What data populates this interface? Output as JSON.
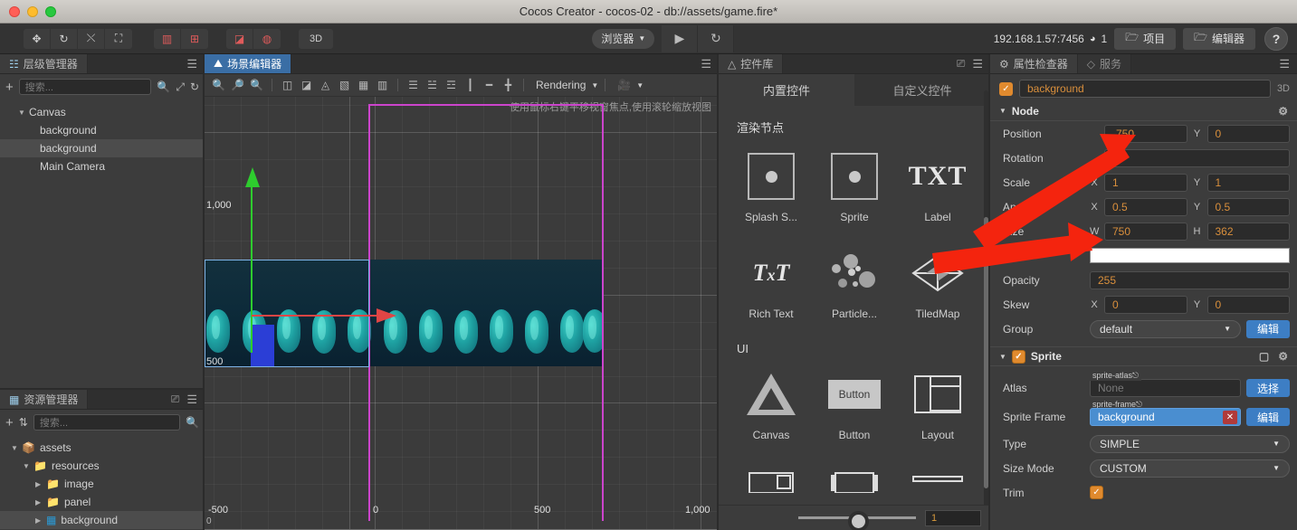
{
  "window": {
    "title": "Cocos Creator - cocos-02 - db://assets/game.fire*"
  },
  "toolbar": {
    "transform_tools": [
      {
        "name": "move-tool",
        "glyph": "✥"
      },
      {
        "name": "rotate-tool",
        "glyph": "⟳"
      },
      {
        "name": "scale-tool",
        "glyph": "⤢"
      },
      {
        "name": "rect-tool",
        "glyph": "⛶"
      }
    ],
    "pivot_tools": [
      {
        "name": "pivot-tool",
        "glyph": "▦"
      },
      {
        "name": "coord-tool",
        "glyph": "⊞"
      }
    ],
    "align_tools": [
      {
        "name": "align-tool",
        "glyph": "◲"
      },
      {
        "name": "lock-tool",
        "glyph": "◍"
      }
    ],
    "mode_3d_label": "3D",
    "preview_target": "浏览器",
    "play_glyph": "▶",
    "refresh_glyph": "↻",
    "address": "192.168.1.57:7456",
    "device_count": "1",
    "project_label": "项目",
    "editor_label": "编辑器",
    "help_label": "?"
  },
  "hierarchy": {
    "tab_label": "层级管理器",
    "search_placeholder": "搜索...",
    "nodes": [
      {
        "label": "Canvas",
        "depth": 0,
        "expandable": true,
        "selected": false
      },
      {
        "label": "background",
        "depth": 1,
        "expandable": false,
        "selected": false
      },
      {
        "label": "background",
        "depth": 1,
        "expandable": false,
        "selected": true
      },
      {
        "label": "Main Camera",
        "depth": 1,
        "expandable": false,
        "selected": false
      }
    ]
  },
  "assets": {
    "tab_label": "资源管理器",
    "search_placeholder": "搜索...",
    "nodes": [
      {
        "label": "assets",
        "depth": 0,
        "expandable": true,
        "selected": false,
        "icon": "package-icon"
      },
      {
        "label": "resources",
        "depth": 1,
        "expandable": true,
        "selected": false,
        "icon": "folder-icon"
      },
      {
        "label": "image",
        "depth": 2,
        "expandable": true,
        "selected": false,
        "icon": "folder-icon"
      },
      {
        "label": "panel",
        "depth": 2,
        "expandable": true,
        "selected": false,
        "icon": "folder-icon"
      },
      {
        "label": "background",
        "depth": 2,
        "expandable": true,
        "selected": true,
        "icon": "texture-icon"
      }
    ]
  },
  "scene": {
    "tab_label": "场景编辑器",
    "rendering_label": "Rendering",
    "hint": "使用鼠标右键平移视窗焦点,使用滚轮缩放视图",
    "axis_labels": {
      "y_1000": "1,000",
      "y_500": "500",
      "x_neg500": "-500",
      "x_0": "0",
      "x_500": "500",
      "x_1000": "1,000",
      "origin": "0"
    }
  },
  "widgets": {
    "tab_label": "控件库",
    "tabs": [
      {
        "label": "内置控件",
        "active": true
      },
      {
        "label": "自定义控件",
        "active": false
      }
    ],
    "sections": [
      {
        "title": "渲染节点",
        "items": [
          {
            "label": "Splash S...",
            "icon": "splash-icon"
          },
          {
            "label": "Sprite",
            "icon": "sprite-icon"
          },
          {
            "label": "Label",
            "icon": "txt-icon"
          },
          {
            "label": "Rich Text",
            "icon": "rich-text-icon"
          },
          {
            "label": "Particle...",
            "icon": "particle-icon"
          },
          {
            "label": "TiledMap",
            "icon": "tiledmap-icon"
          }
        ]
      },
      {
        "title": "UI",
        "items": [
          {
            "label": "Canvas",
            "icon": "canvas-icon"
          },
          {
            "label": "Button",
            "icon": "button-icon"
          },
          {
            "label": "Layout",
            "icon": "layout-icon"
          }
        ]
      }
    ],
    "zoom_value": "1"
  },
  "inspector": {
    "tabs": [
      {
        "label": "属性检查器",
        "active": true
      },
      {
        "label": "服务",
        "active": false
      }
    ],
    "node_name": "background",
    "node_enabled": true,
    "mode_3d_label": "3D",
    "node_section": {
      "title": "Node",
      "position": {
        "label": "Position",
        "x": "-750",
        "y": "0",
        "x_axis": "",
        "y_axis": "Y"
      },
      "rotation": {
        "label": "Rotation",
        "value": "0"
      },
      "scale": {
        "label": "Scale",
        "x_axis": "X",
        "x": "1",
        "y_axis": "Y",
        "y": "1"
      },
      "anchor": {
        "label": "Anchor",
        "x_axis": "X",
        "x": "0.5",
        "y_axis": "Y",
        "y": "0.5"
      },
      "size": {
        "label": "Size",
        "w_axis": "W",
        "w": "750",
        "h_axis": "H",
        "h": "362"
      },
      "color": {
        "label": "Color",
        "value": "#FFFFFF"
      },
      "opacity": {
        "label": "Opacity",
        "value": "255"
      },
      "skew": {
        "label": "Skew",
        "x_axis": "X",
        "x": "0",
        "y_axis": "Y",
        "y": "0"
      },
      "group": {
        "label": "Group",
        "value": "default",
        "edit_label": "编辑"
      }
    },
    "sprite_section": {
      "title": "Sprite",
      "enabled": true,
      "atlas": {
        "label": "Atlas",
        "badge": "sprite-atlas",
        "value": "None",
        "button": "选择"
      },
      "sprite_frame": {
        "label": "Sprite Frame",
        "badge": "sprite-frame",
        "value": "background",
        "button": "编辑"
      },
      "type": {
        "label": "Type",
        "value": "SIMPLE"
      },
      "size_mode": {
        "label": "Size Mode",
        "value": "CUSTOM"
      },
      "trim": {
        "label": "Trim",
        "checked": true
      }
    }
  },
  "colors": {
    "accent_orange": "#d98f3c",
    "accent_blue": "#3d7ec4",
    "tab_blue": "#3a6ea5",
    "annotation_red": "#f4240e",
    "canvas_magenta": "#cc44cc",
    "gizmo_green": "#2ecc2e",
    "gizmo_red": "#e04545"
  }
}
